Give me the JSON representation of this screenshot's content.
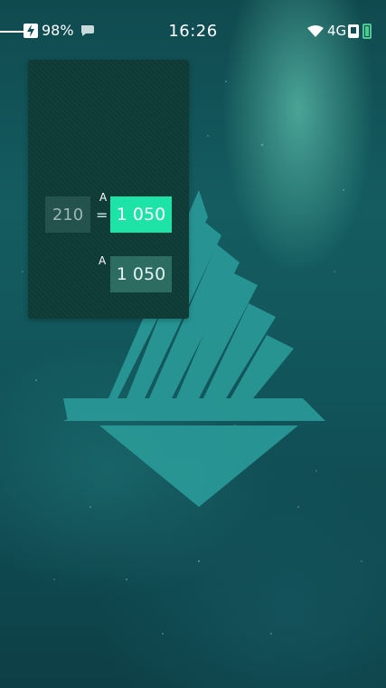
{
  "status_bar": {
    "battery_percent": "98%",
    "time": "16:26",
    "network": "4G",
    "icons": [
      "charging-icon",
      "chat-icon",
      "wifi-icon",
      "sim-icon",
      "battery-icon"
    ]
  },
  "widget": {
    "input_value": "210",
    "equals_sign": "=",
    "unit_label_1": "A",
    "result_value": "1 050",
    "unit_label_2": "A",
    "secondary_value": "1 050"
  },
  "colors": {
    "accent": "#1ee3a7",
    "widget_bg": "#0e3a35",
    "secondary_box": "#2d6c61",
    "logo": "#2a9b99"
  }
}
